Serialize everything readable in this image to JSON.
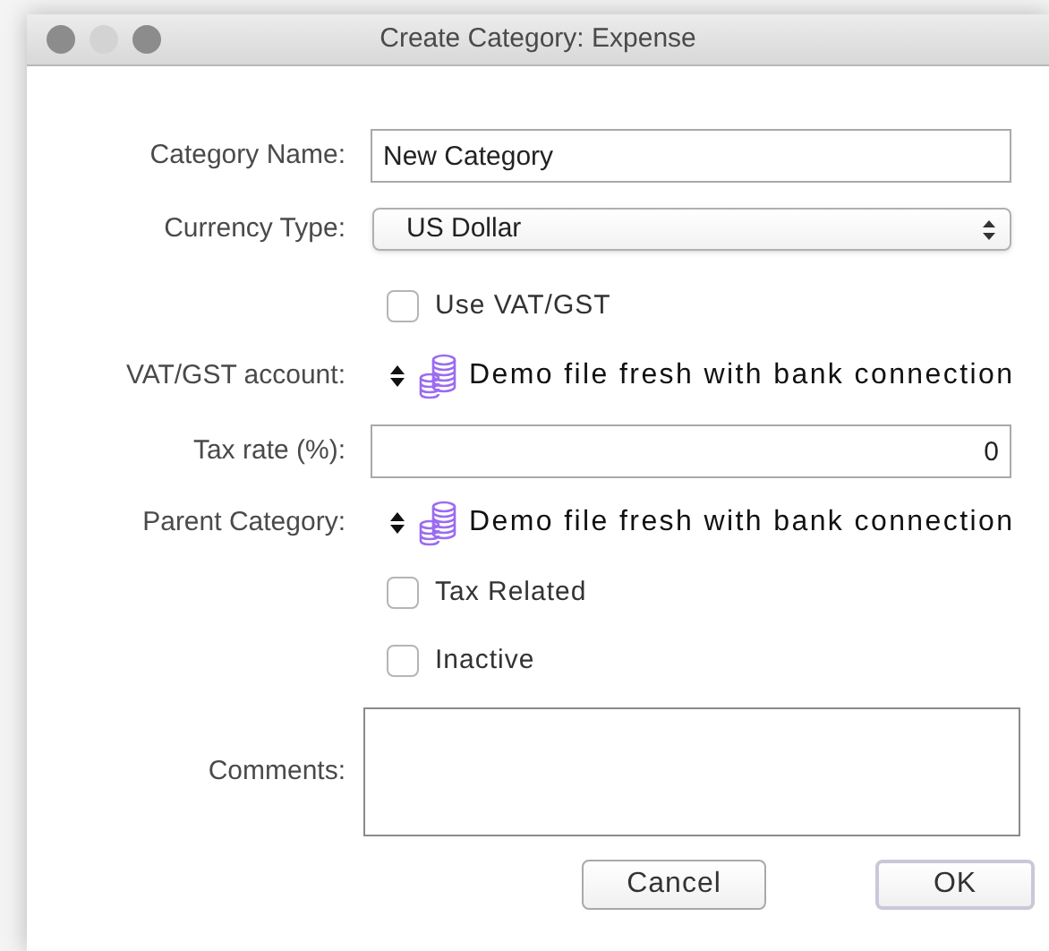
{
  "window": {
    "title": "Create Category: Expense"
  },
  "rows": [
    {
      "kind": "text",
      "label": "Category Name:",
      "value": "New Category"
    },
    {
      "kind": "select",
      "label": "Currency Type:",
      "value": "US Dollar"
    },
    {
      "kind": "checkbox",
      "label": "Use VAT/GST",
      "checked": false
    },
    {
      "kind": "account",
      "label": "VAT/GST account:",
      "value": "Demo file fresh with bank connection"
    },
    {
      "kind": "number",
      "label": "Tax rate (%):",
      "value": "0"
    },
    {
      "kind": "account",
      "label": "Parent Category:",
      "value": "Demo file fresh with bank connection"
    },
    {
      "kind": "checkbox",
      "label": "Tax Related",
      "checked": false
    },
    {
      "kind": "checkbox",
      "label": "Inactive",
      "checked": false
    },
    {
      "kind": "textarea",
      "label": "Comments:"
    }
  ],
  "buttons": [
    {
      "label": "Cancel",
      "default": false
    },
    {
      "label": "OK",
      "default": true
    }
  ]
}
